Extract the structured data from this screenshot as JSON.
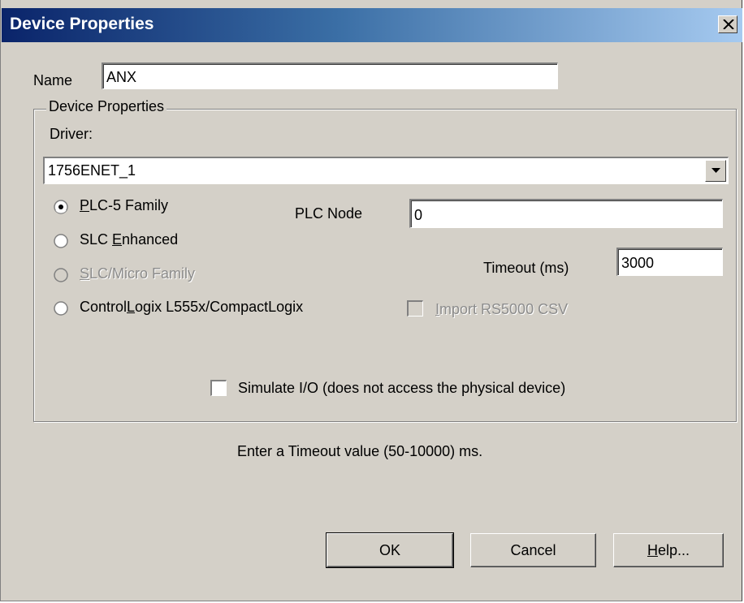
{
  "window": {
    "title": "Device Properties",
    "close_glyph": "✕"
  },
  "name_field": {
    "label": "Name",
    "value": "ANX"
  },
  "group": {
    "legend": "Device Properties",
    "driver_label": "Driver:",
    "driver_value": "1756ENET_1"
  },
  "plc_family": [
    {
      "label": "PLC-5 Family",
      "mnemonic": "P",
      "checked": true,
      "enabled": true
    },
    {
      "label": "SLC Enhanced",
      "mnemonic": "E",
      "checked": false,
      "enabled": true
    },
    {
      "label": "SLC/Micro Family",
      "mnemonic": "S",
      "checked": false,
      "enabled": false
    },
    {
      "label": "ControlLogix L555x/CompactLogix",
      "mnemonic": "L",
      "checked": false,
      "enabled": true
    }
  ],
  "plc_node": {
    "label": "PLC Node",
    "value": "0"
  },
  "timeout": {
    "label": "Timeout (ms)",
    "value": "3000"
  },
  "import_csv": {
    "label": "Import RS5000 CSV",
    "mnemonic": "I",
    "checked": false,
    "enabled": false
  },
  "simulate_io": {
    "label": "Simulate I/O (does not access the physical device)",
    "checked": false
  },
  "hint": "Enter a Timeout value (50-10000) ms.",
  "buttons": {
    "ok": "OK",
    "cancel": "Cancel",
    "help": "Help..."
  },
  "colors": {
    "face": "#d4d0c8",
    "title_start": "#0a246a",
    "title_end": "#a6caf0",
    "disabled_text": "#8c8c8c"
  }
}
